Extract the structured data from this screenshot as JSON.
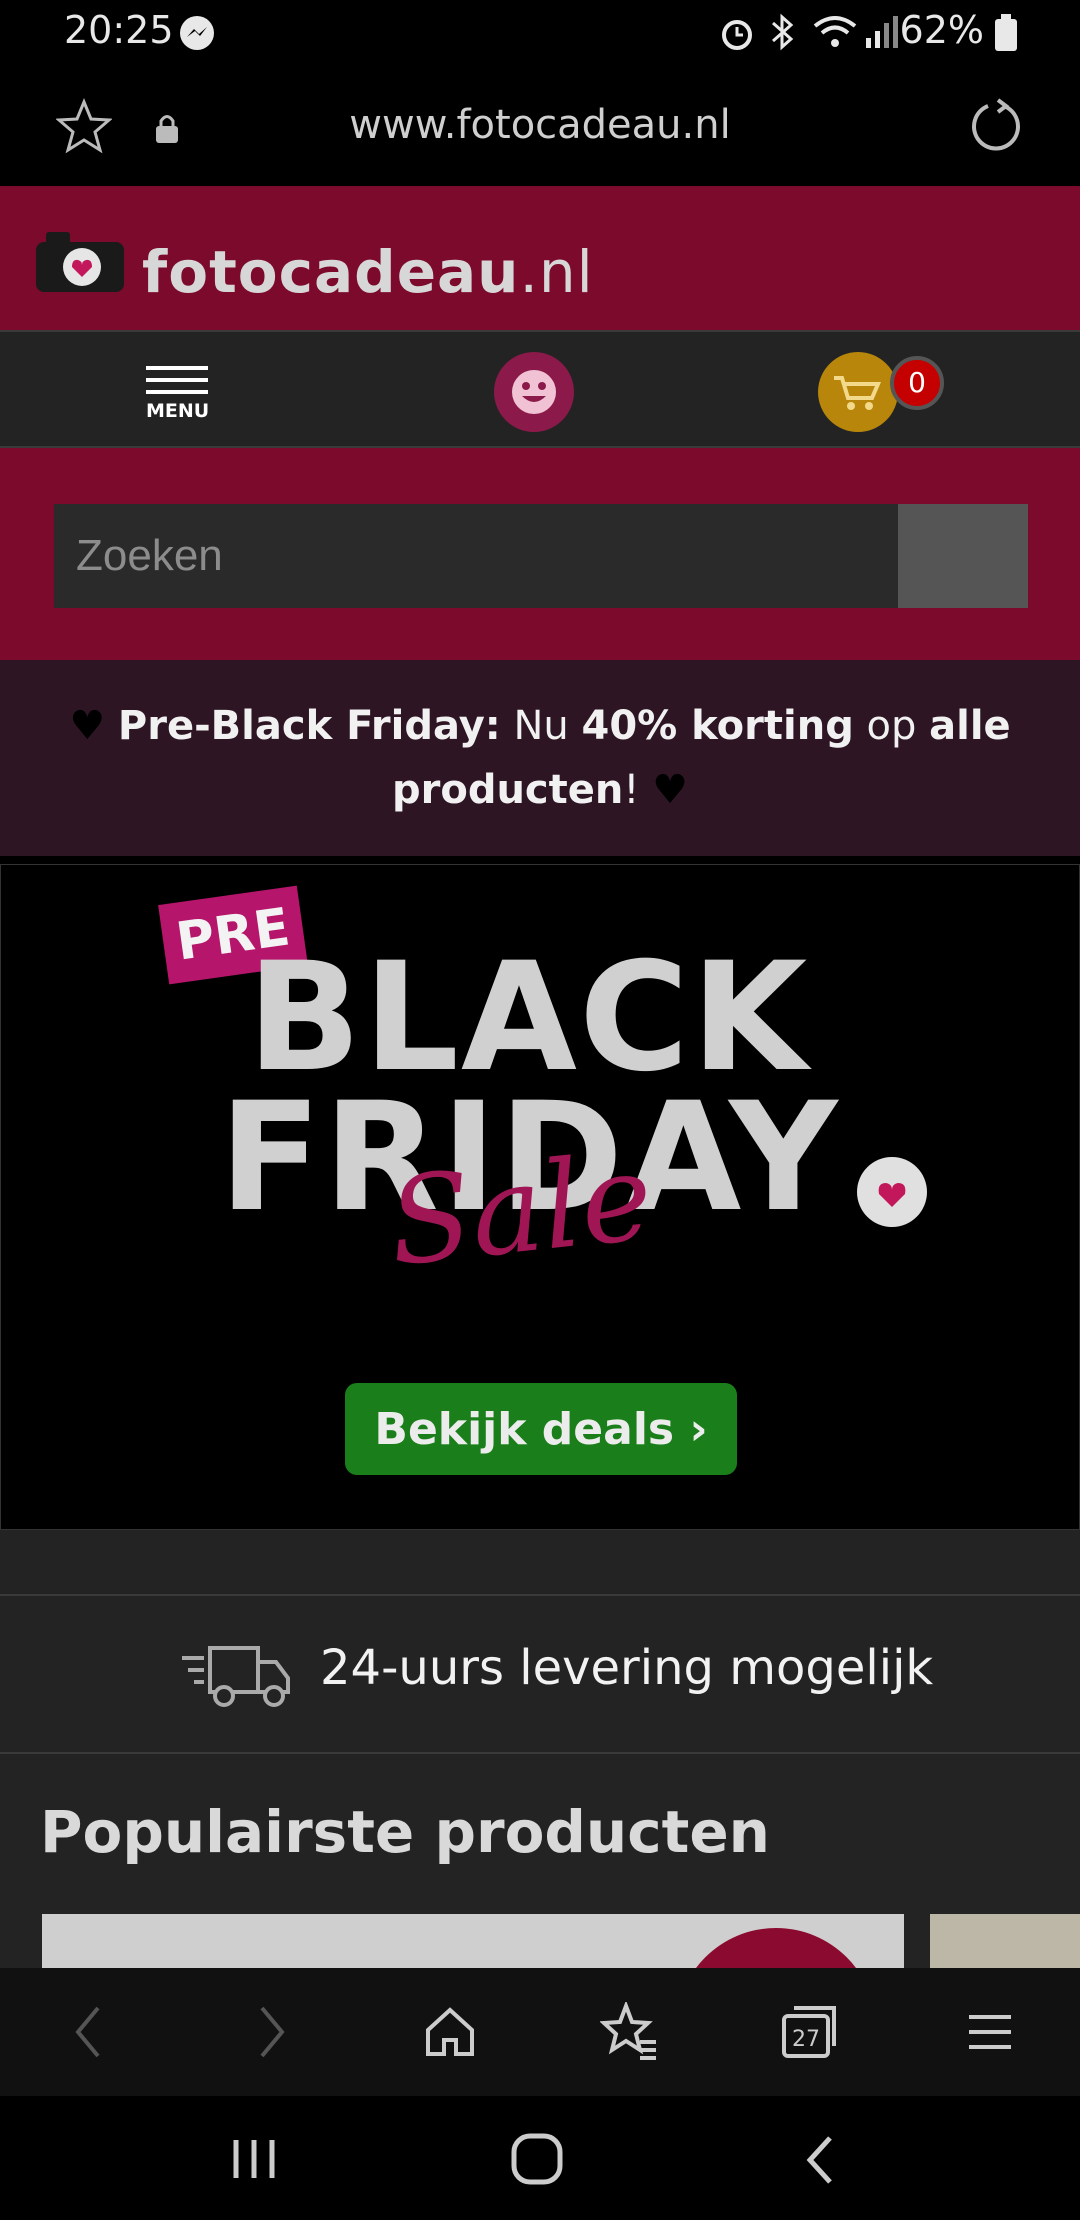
{
  "status_bar": {
    "time": "20:25",
    "battery": "62%"
  },
  "browser": {
    "url": "www.fotocadeau.nl",
    "tab_count": "27"
  },
  "site": {
    "logo_part1": "fotocadeau",
    "logo_part2": ".nl",
    "menu_label": "MENU",
    "cart_count": "0",
    "search_placeholder": "Zoeken"
  },
  "promo": {
    "part1": "Pre-Black Friday:",
    "part2": " Nu ",
    "part3": "40% korting",
    "part4": " op ",
    "part5": "alle",
    "part6": "producten",
    "part7": "!"
  },
  "hero": {
    "pre": "PRE",
    "black": "BLACK",
    "friday": "FRIDAY",
    "sale": "Sale",
    "button": "Bekijk deals"
  },
  "delivery": {
    "text": "24-uurs levering mogelijk"
  },
  "products": {
    "title": "Populairste producten"
  },
  "colors": {
    "brand": "#7c0a2c",
    "promo_bg": "#2d1523",
    "deals_green": "#1a7f1a",
    "cart_yellow": "#b8860b",
    "account_pink": "#8b1a4a"
  }
}
